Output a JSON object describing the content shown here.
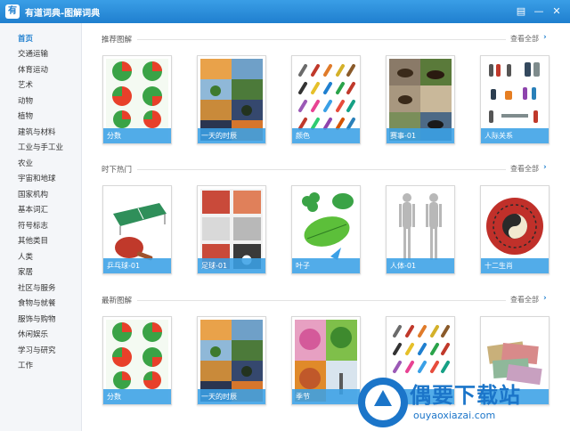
{
  "window": {
    "logo_glyph": "有",
    "title": "有道词典-图解词典",
    "btn_menu": "▤",
    "btn_min": "—",
    "btn_close": "✕"
  },
  "sidebar": {
    "items": [
      {
        "label": "首页",
        "active": true
      },
      {
        "label": "交通运输"
      },
      {
        "label": "体育运动"
      },
      {
        "label": "艺术"
      },
      {
        "label": "动物"
      },
      {
        "label": "植物"
      },
      {
        "label": "建筑与材料"
      },
      {
        "label": "工业与手工业"
      },
      {
        "label": "农业"
      },
      {
        "label": "宇宙和地球"
      },
      {
        "label": "国家机构"
      },
      {
        "label": "基本词汇"
      },
      {
        "label": "符号标志"
      },
      {
        "label": "其他类目"
      },
      {
        "label": "人类"
      },
      {
        "label": "家居"
      },
      {
        "label": "社区与服务"
      },
      {
        "label": "食物与就餐"
      },
      {
        "label": "服饰与购物"
      },
      {
        "label": "休闲娱乐"
      },
      {
        "label": "学习与研究"
      },
      {
        "label": "工作"
      }
    ]
  },
  "sections": [
    {
      "title": "推荐图解",
      "see_all": "查看全部",
      "arrow": "›",
      "cards": [
        "分数",
        "一天的时辰",
        "颜色",
        "赛事-01",
        "人际关系"
      ]
    },
    {
      "title": "时下热门",
      "see_all": "查看全部",
      "arrow": "›",
      "cards": [
        "乒乓球-01",
        "足球-01",
        "叶子",
        "人体-01",
        "十二生肖"
      ]
    },
    {
      "title": "最新图解",
      "see_all": "查看全部",
      "arrow": "›",
      "cards": [
        "分数",
        "一天的时辰",
        "季节",
        "",
        ""
      ]
    }
  ],
  "watermark": {
    "text": "偶要下载站",
    "url": "ouyaoxiazai.com"
  },
  "colors": {
    "titlebar": "#2a8fdc",
    "accent": "#1f7fcf",
    "caption": "#3aa0e6"
  }
}
